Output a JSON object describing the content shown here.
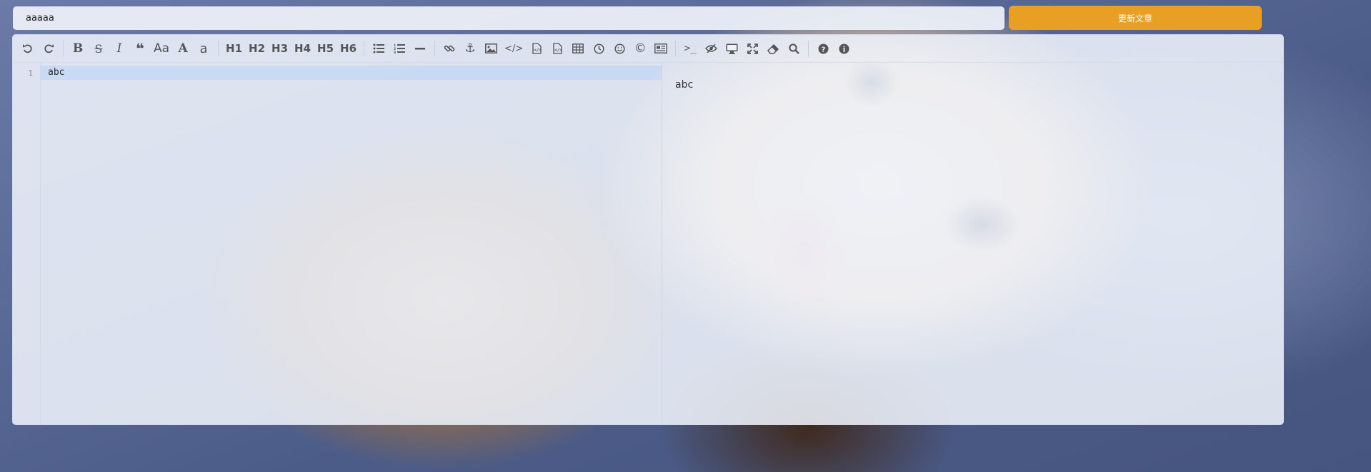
{
  "title_input": {
    "value": "aaaaa"
  },
  "update_button": {
    "label": "更新文章"
  },
  "toolbar": {
    "groups": [
      [
        "undo",
        "redo"
      ],
      [
        "bold",
        "strikethrough",
        "italic",
        "quote",
        "case-toggle",
        "uppercase",
        "lowercase"
      ],
      [
        "H1",
        "H2",
        "H3",
        "H4",
        "H5",
        "H6"
      ],
      [
        "unordered-list",
        "ordered-list",
        "horizontal-rule"
      ],
      [
        "link",
        "anchor",
        "image",
        "code",
        "preformatted-code",
        "code-block",
        "table",
        "datetime",
        "emoji",
        "html-entities",
        "pagebreak"
      ],
      [
        "goto-line",
        "watch",
        "preview",
        "fullscreen",
        "clear",
        "search"
      ],
      [
        "help",
        "info"
      ]
    ],
    "labels": {
      "case_toggle": "Aa",
      "uppercase": "A",
      "lowercase": "a",
      "h1": "H1",
      "h2": "H2",
      "h3": "H3",
      "h4": "H4",
      "h5": "H5",
      "h6": "H6"
    }
  },
  "editor": {
    "line_numbers": [
      "1"
    ],
    "lines": [
      "abc"
    ]
  },
  "preview": {
    "content": "abc"
  }
}
